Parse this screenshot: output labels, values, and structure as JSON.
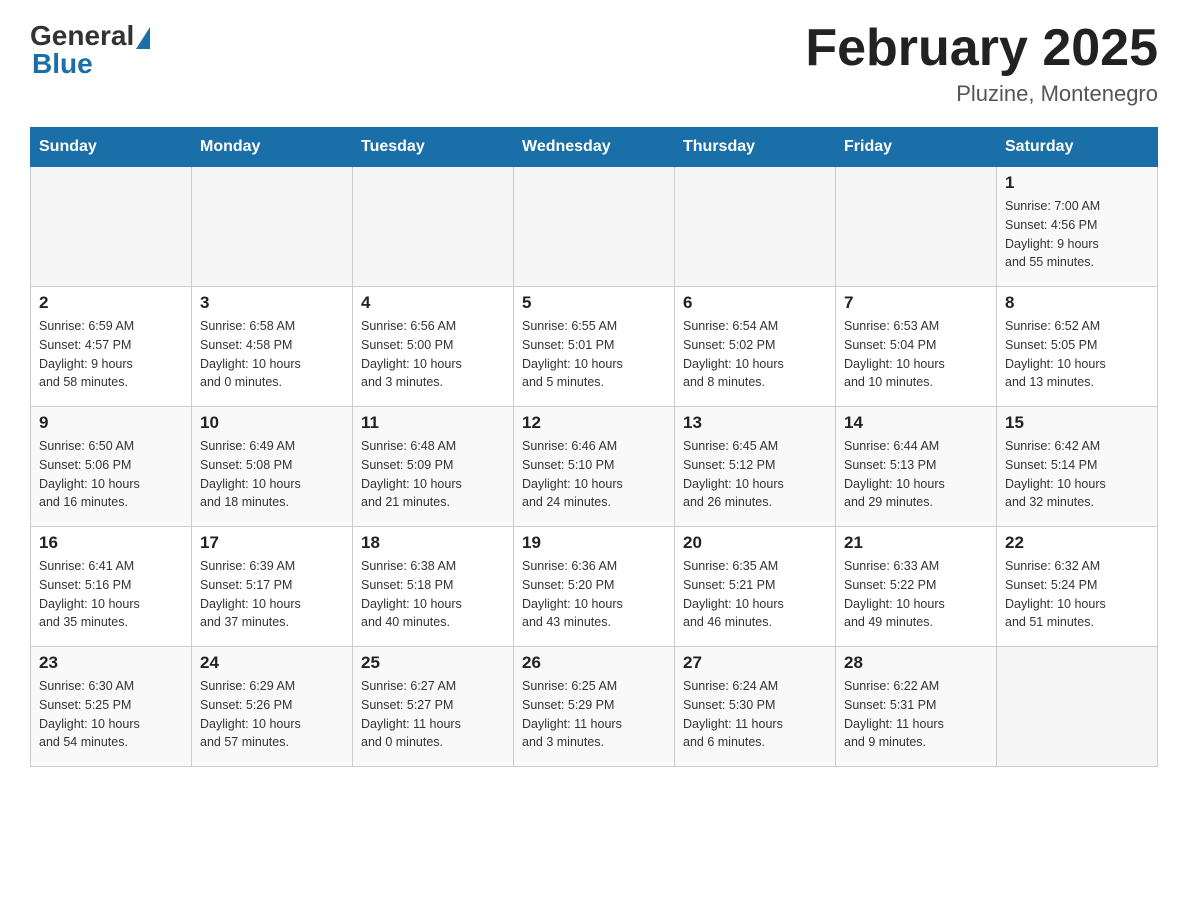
{
  "header": {
    "logo": {
      "general": "General",
      "blue": "Blue"
    },
    "title": "February 2025",
    "location": "Pluzine, Montenegro"
  },
  "days_of_week": [
    "Sunday",
    "Monday",
    "Tuesday",
    "Wednesday",
    "Thursday",
    "Friday",
    "Saturday"
  ],
  "weeks": [
    [
      {
        "day": "",
        "info": ""
      },
      {
        "day": "",
        "info": ""
      },
      {
        "day": "",
        "info": ""
      },
      {
        "day": "",
        "info": ""
      },
      {
        "day": "",
        "info": ""
      },
      {
        "day": "",
        "info": ""
      },
      {
        "day": "1",
        "info": "Sunrise: 7:00 AM\nSunset: 4:56 PM\nDaylight: 9 hours\nand 55 minutes."
      }
    ],
    [
      {
        "day": "2",
        "info": "Sunrise: 6:59 AM\nSunset: 4:57 PM\nDaylight: 9 hours\nand 58 minutes."
      },
      {
        "day": "3",
        "info": "Sunrise: 6:58 AM\nSunset: 4:58 PM\nDaylight: 10 hours\nand 0 minutes."
      },
      {
        "day": "4",
        "info": "Sunrise: 6:56 AM\nSunset: 5:00 PM\nDaylight: 10 hours\nand 3 minutes."
      },
      {
        "day": "5",
        "info": "Sunrise: 6:55 AM\nSunset: 5:01 PM\nDaylight: 10 hours\nand 5 minutes."
      },
      {
        "day": "6",
        "info": "Sunrise: 6:54 AM\nSunset: 5:02 PM\nDaylight: 10 hours\nand 8 minutes."
      },
      {
        "day": "7",
        "info": "Sunrise: 6:53 AM\nSunset: 5:04 PM\nDaylight: 10 hours\nand 10 minutes."
      },
      {
        "day": "8",
        "info": "Sunrise: 6:52 AM\nSunset: 5:05 PM\nDaylight: 10 hours\nand 13 minutes."
      }
    ],
    [
      {
        "day": "9",
        "info": "Sunrise: 6:50 AM\nSunset: 5:06 PM\nDaylight: 10 hours\nand 16 minutes."
      },
      {
        "day": "10",
        "info": "Sunrise: 6:49 AM\nSunset: 5:08 PM\nDaylight: 10 hours\nand 18 minutes."
      },
      {
        "day": "11",
        "info": "Sunrise: 6:48 AM\nSunset: 5:09 PM\nDaylight: 10 hours\nand 21 minutes."
      },
      {
        "day": "12",
        "info": "Sunrise: 6:46 AM\nSunset: 5:10 PM\nDaylight: 10 hours\nand 24 minutes."
      },
      {
        "day": "13",
        "info": "Sunrise: 6:45 AM\nSunset: 5:12 PM\nDaylight: 10 hours\nand 26 minutes."
      },
      {
        "day": "14",
        "info": "Sunrise: 6:44 AM\nSunset: 5:13 PM\nDaylight: 10 hours\nand 29 minutes."
      },
      {
        "day": "15",
        "info": "Sunrise: 6:42 AM\nSunset: 5:14 PM\nDaylight: 10 hours\nand 32 minutes."
      }
    ],
    [
      {
        "day": "16",
        "info": "Sunrise: 6:41 AM\nSunset: 5:16 PM\nDaylight: 10 hours\nand 35 minutes."
      },
      {
        "day": "17",
        "info": "Sunrise: 6:39 AM\nSunset: 5:17 PM\nDaylight: 10 hours\nand 37 minutes."
      },
      {
        "day": "18",
        "info": "Sunrise: 6:38 AM\nSunset: 5:18 PM\nDaylight: 10 hours\nand 40 minutes."
      },
      {
        "day": "19",
        "info": "Sunrise: 6:36 AM\nSunset: 5:20 PM\nDaylight: 10 hours\nand 43 minutes."
      },
      {
        "day": "20",
        "info": "Sunrise: 6:35 AM\nSunset: 5:21 PM\nDaylight: 10 hours\nand 46 minutes."
      },
      {
        "day": "21",
        "info": "Sunrise: 6:33 AM\nSunset: 5:22 PM\nDaylight: 10 hours\nand 49 minutes."
      },
      {
        "day": "22",
        "info": "Sunrise: 6:32 AM\nSunset: 5:24 PM\nDaylight: 10 hours\nand 51 minutes."
      }
    ],
    [
      {
        "day": "23",
        "info": "Sunrise: 6:30 AM\nSunset: 5:25 PM\nDaylight: 10 hours\nand 54 minutes."
      },
      {
        "day": "24",
        "info": "Sunrise: 6:29 AM\nSunset: 5:26 PM\nDaylight: 10 hours\nand 57 minutes."
      },
      {
        "day": "25",
        "info": "Sunrise: 6:27 AM\nSunset: 5:27 PM\nDaylight: 11 hours\nand 0 minutes."
      },
      {
        "day": "26",
        "info": "Sunrise: 6:25 AM\nSunset: 5:29 PM\nDaylight: 11 hours\nand 3 minutes."
      },
      {
        "day": "27",
        "info": "Sunrise: 6:24 AM\nSunset: 5:30 PM\nDaylight: 11 hours\nand 6 minutes."
      },
      {
        "day": "28",
        "info": "Sunrise: 6:22 AM\nSunset: 5:31 PM\nDaylight: 11 hours\nand 9 minutes."
      },
      {
        "day": "",
        "info": ""
      }
    ]
  ]
}
